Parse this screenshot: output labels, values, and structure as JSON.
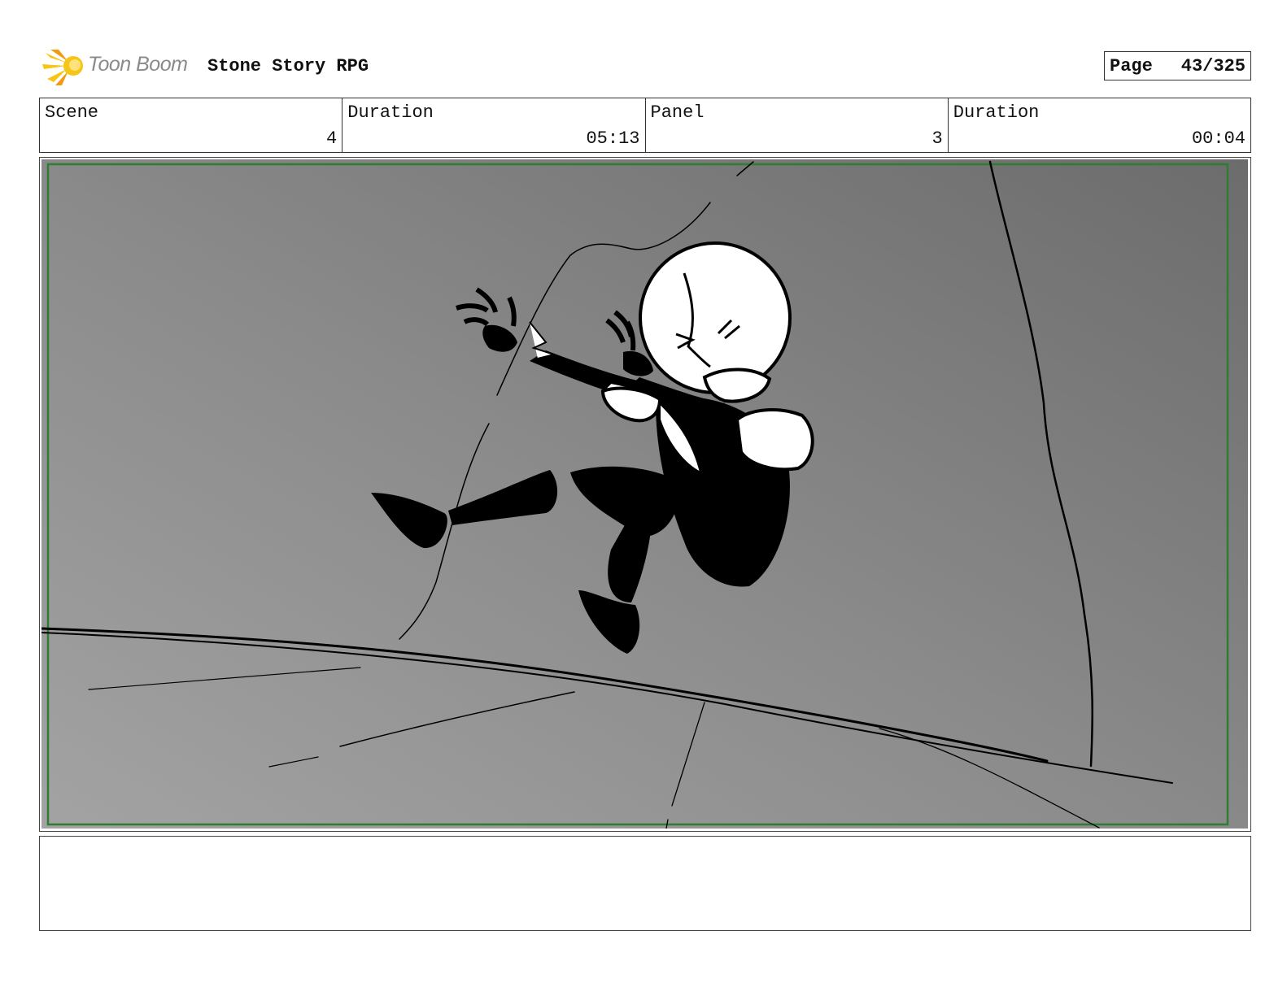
{
  "header": {
    "brand": "Toon Boom",
    "project_title": "Stone Story RPG",
    "page_label": "Page",
    "page_number": "43/325"
  },
  "info": {
    "scene_label": "Scene",
    "scene_value": "4",
    "scene_duration_label": "Duration",
    "scene_duration_value": "05:13",
    "panel_label": "Panel",
    "panel_value": "3",
    "panel_duration_label": "Duration",
    "panel_duration_value": "00:04"
  },
  "notes": {
    "text": ""
  },
  "colors": {
    "safe_frame": "#2e7d32",
    "logo_yellow": "#f5c518",
    "logo_orange": "#f29b12"
  }
}
